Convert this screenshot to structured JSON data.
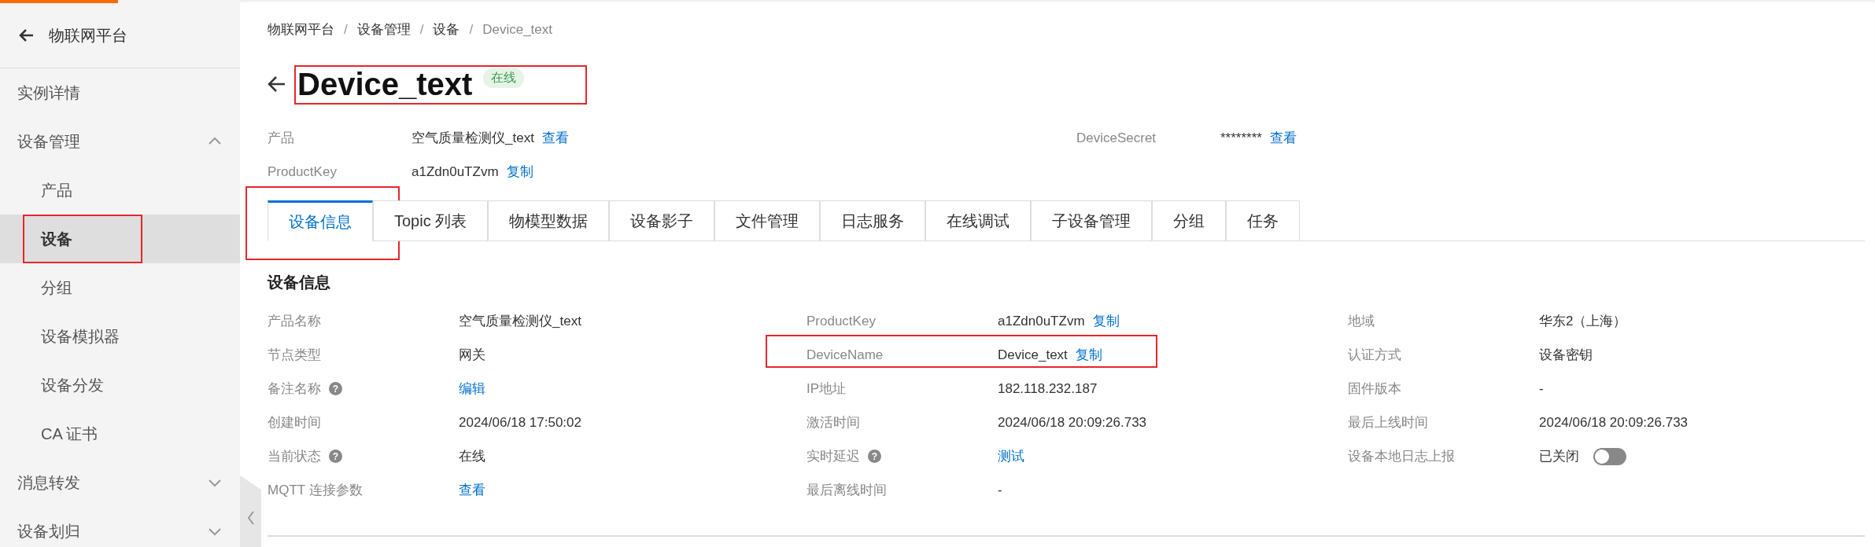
{
  "sidebar": {
    "title": "物联网平台",
    "items": [
      {
        "label": "实例详情",
        "selected": false
      },
      {
        "label": "设备管理",
        "selected": false,
        "expanded": true,
        "children": [
          {
            "label": "产品",
            "selected": false,
            "highlight": false
          },
          {
            "label": "设备",
            "selected": true,
            "highlight": true
          },
          {
            "label": "分组",
            "selected": false,
            "highlight": false
          },
          {
            "label": "设备模拟器",
            "selected": false,
            "highlight": false
          },
          {
            "label": "设备分发",
            "selected": false,
            "highlight": false
          },
          {
            "label": "CA 证书",
            "selected": false,
            "highlight": false
          }
        ]
      },
      {
        "label": "消息转发",
        "selected": false,
        "expanded": false
      },
      {
        "label": "设备划归",
        "selected": false,
        "expanded": false
      }
    ]
  },
  "breadcrumb": {
    "separator": "/",
    "items": [
      "物联网平台",
      "设备管理",
      "设备",
      "Device_text"
    ]
  },
  "header": {
    "title": "Device_text",
    "status": "在线",
    "highlight": true
  },
  "summary": [
    {
      "label": "产品",
      "value": "空气质量检测仪_text",
      "action": "查看"
    },
    {
      "label": "ProductKey",
      "value": "a1Zdn0uTZvm",
      "action": "复制"
    },
    {
      "label": "DeviceSecret",
      "value": "********",
      "action": "查看"
    }
  ],
  "tabs": [
    {
      "label": "设备信息",
      "selected": true,
      "highlight": true
    },
    {
      "label": "Topic 列表",
      "selected": false,
      "highlight": false
    },
    {
      "label": "物模型数据",
      "selected": false,
      "highlight": false
    },
    {
      "label": "设备影子",
      "selected": false,
      "highlight": false
    },
    {
      "label": "文件管理",
      "selected": false,
      "highlight": false
    },
    {
      "label": "日志服务",
      "selected": false,
      "highlight": false
    },
    {
      "label": "在线调试",
      "selected": false,
      "highlight": false
    },
    {
      "label": "子设备管理",
      "selected": false,
      "highlight": false
    },
    {
      "label": "分组",
      "selected": false,
      "highlight": false
    },
    {
      "label": "任务",
      "selected": false,
      "highlight": false
    }
  ],
  "section": {
    "title": "设备信息",
    "fields": [
      {
        "kind": "text",
        "label": "产品名称",
        "value": "空气质量检测仪_text"
      },
      {
        "kind": "text",
        "label": "ProductKey",
        "value": "a1Zdn0uTZvm",
        "action": "复制"
      },
      {
        "kind": "text",
        "label": "地域",
        "value": "华东2（上海）"
      },
      {
        "kind": "text",
        "label": "节点类型",
        "value": "网关"
      },
      {
        "kind": "text",
        "label": "DeviceName",
        "value": "Device_text",
        "action": "复制",
        "highlight": true
      },
      {
        "kind": "text",
        "label": "认证方式",
        "value": "设备密钥"
      },
      {
        "kind": "link",
        "label": "备注名称",
        "help": "?",
        "value": "编辑"
      },
      {
        "kind": "text",
        "label": "IP地址",
        "value": "182.118.232.187"
      },
      {
        "kind": "text",
        "label": "固件版本",
        "value": "-"
      },
      {
        "kind": "text",
        "label": "创建时间",
        "value": "2024/06/18 17:50:02"
      },
      {
        "kind": "text",
        "label": "激活时间",
        "value": "2024/06/18 20:09:26.733"
      },
      {
        "kind": "text",
        "label": "最后上线时间",
        "value": "2024/06/18 20:09:26.733"
      },
      {
        "kind": "text",
        "label": "当前状态",
        "help": "?",
        "value": "在线"
      },
      {
        "kind": "link",
        "label": "实时延迟",
        "help": "?",
        "value": "测试"
      },
      {
        "kind": "toggle",
        "label": "设备本地日志上报",
        "value": "已关闭",
        "on": false
      },
      {
        "kind": "link",
        "label": "MQTT 连接参数",
        "value": "查看"
      },
      {
        "kind": "text",
        "label": "最后离线时间",
        "value": "-"
      }
    ]
  }
}
